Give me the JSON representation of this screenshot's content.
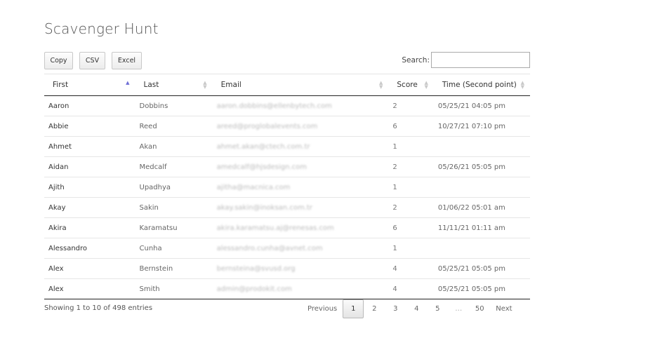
{
  "page": {
    "title": "Scavenger Hunt"
  },
  "toolbar": {
    "copy_label": "Copy",
    "csv_label": "CSV",
    "excel_label": "Excel"
  },
  "search": {
    "label": "Search:",
    "value": ""
  },
  "table": {
    "columns": [
      "First",
      "Last",
      "Email",
      "Score",
      "Time (Second point)"
    ],
    "sorted_column": "First",
    "sort_direction": "ascending",
    "rows": [
      {
        "first": "Aaron",
        "last": "Dobbins",
        "email": "aaron.dobbins@ellenbytech.com",
        "score": "2",
        "time": "05/25/21 04:05 pm"
      },
      {
        "first": "Abbie",
        "last": "Reed",
        "email": "areed@proglobalevents.com",
        "score": "6",
        "time": "10/27/21 07:10 pm"
      },
      {
        "first": "Ahmet",
        "last": "Akan",
        "email": "ahmet.akan@ctech.com.tr",
        "score": "1",
        "time": ""
      },
      {
        "first": "Aidan",
        "last": "Medcalf",
        "email": "amedcalf@hjsdesign.com",
        "score": "2",
        "time": "05/26/21 05:05 pm"
      },
      {
        "first": "Ajith",
        "last": "Upadhya",
        "email": "ajitha@macnica.com",
        "score": "1",
        "time": ""
      },
      {
        "first": "Akay",
        "last": "Sakin",
        "email": "akay.sakin@inoksan.com.tr",
        "score": "2",
        "time": "01/06/22 05:01 am"
      },
      {
        "first": "Akira",
        "last": "Karamatsu",
        "email": "akira.karamatsu.aj@renesas.com",
        "score": "6",
        "time": "11/11/21 01:11 am"
      },
      {
        "first": "Alessandro",
        "last": "Cunha",
        "email": "alessandro.cunha@avnet.com",
        "score": "1",
        "time": ""
      },
      {
        "first": "Alex",
        "last": "Bernstein",
        "email": "bernsteina@svusd.org",
        "score": "4",
        "time": "05/25/21 05:05 pm"
      },
      {
        "first": "Alex",
        "last": "Smith",
        "email": "admin@prodokit.com",
        "score": "4",
        "time": "05/25/21 05:05 pm"
      }
    ]
  },
  "footer": {
    "info": "Showing 1 to 10 of 498 entries"
  },
  "pagination": {
    "previous": "Previous",
    "next": "Next",
    "pages": [
      "1",
      "2",
      "3",
      "4",
      "5"
    ],
    "ellipsis": "…",
    "last_page": "50",
    "current": "1"
  }
}
